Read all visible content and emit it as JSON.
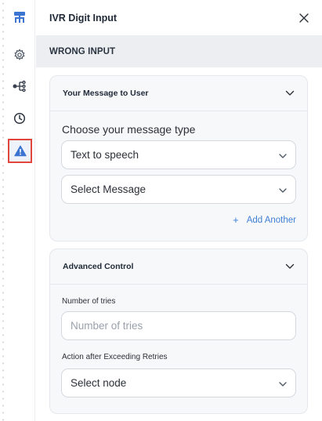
{
  "app": {
    "title": "IVR Digit Input",
    "section": "WRONG INPUT"
  },
  "sidebar": {
    "items": [
      {
        "icon": "flow-logo-icon",
        "active": false
      },
      {
        "icon": "gear-icon",
        "active": false
      },
      {
        "icon": "branch-icon",
        "active": false
      },
      {
        "icon": "clock-icon",
        "active": false
      },
      {
        "icon": "warning-icon",
        "active": true
      }
    ]
  },
  "message_card": {
    "title": "Your Message to User",
    "choose_label": "Choose your message type",
    "type_select": {
      "value": "Text to speech"
    },
    "message_select": {
      "value": "Select Message"
    },
    "add_another_label": "Add Another"
  },
  "advanced_card": {
    "title": "Advanced Control",
    "tries_label": "Number of tries",
    "tries_input": {
      "value": "",
      "placeholder": "Number of tries"
    },
    "action_label": "Action after Exceeding Retries",
    "action_select": {
      "value": "Select node"
    }
  },
  "colors": {
    "accent": "#3f7fd6",
    "active_border": "#e2453c",
    "section_bg": "#eceef1"
  }
}
